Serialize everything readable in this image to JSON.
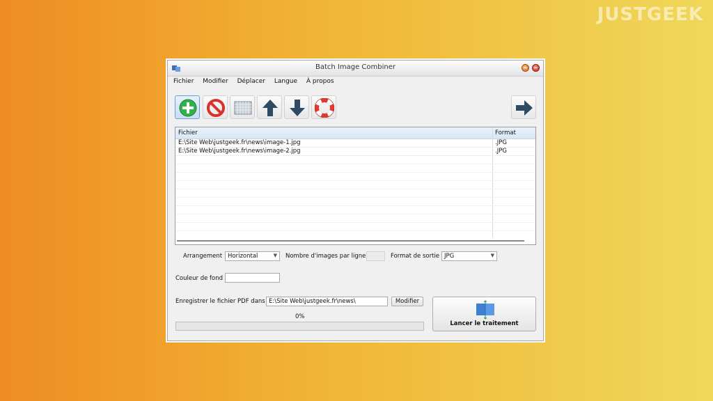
{
  "watermark": "JUSTGEEK",
  "window": {
    "title": "Batch Image Combiner"
  },
  "menu": [
    "Fichier",
    "Modifier",
    "Déplacer",
    "Langue",
    "À propos"
  ],
  "toolbar": {
    "icons": [
      "add-icon",
      "remove-icon",
      "clear-list-icon",
      "move-up-icon",
      "move-down-icon",
      "help-icon",
      "next-arrow-icon"
    ]
  },
  "file_list": {
    "columns": [
      "Fichier",
      "Format"
    ],
    "rows": [
      {
        "file": "E:\\Site Web\\justgeek.fr\\news\\image-1.jpg",
        "format": ".JPG"
      },
      {
        "file": "E:\\Site Web\\justgeek.fr\\news\\image-2.jpg",
        "format": ".JPG"
      }
    ]
  },
  "options": {
    "arrangement_label": "Arrangement",
    "arrangement_value": "Horizontal",
    "images_per_line_label": "Nombre d'images par ligne",
    "images_per_line_value": "",
    "output_format_label": "Format de sortie",
    "output_format_value": "JPG",
    "background_color_label": "Couleur de fond",
    "background_color_value": ""
  },
  "save": {
    "label": "Enregistrer le fichier PDF dans",
    "path": "E:\\Site Web\\justgeek.fr\\news\\",
    "modify_button": "Modifier"
  },
  "launch_button": "Lancer le traitement",
  "progress": {
    "text": "0%",
    "value": 0
  },
  "colors": {
    "add": "#2fb34a",
    "remove": "#d8322a",
    "arrow": "#2f4b63",
    "selected_toolbar": "#c8def3"
  }
}
